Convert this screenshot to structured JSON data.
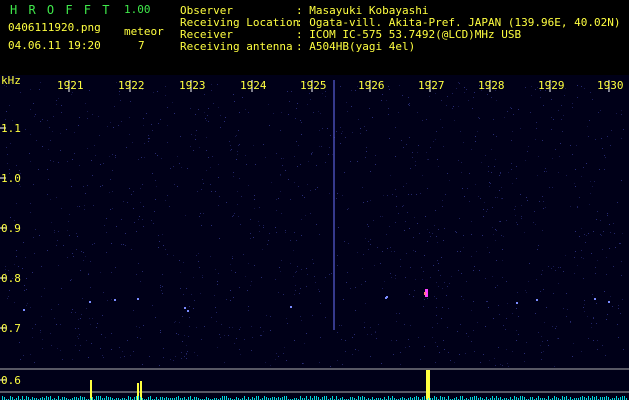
{
  "app": {
    "brand": "H R O F F T",
    "version": "1.00",
    "filename": "0406111920.png",
    "datetime": "04.06.11 19:20",
    "meteor_label": "meteor",
    "meteor_count": "7"
  },
  "info": {
    "rows": [
      {
        "label": "Observer",
        "value": ": Masayuki Kobayashi"
      },
      {
        "label": "Receiving Location",
        "value": ": Ogata-vill. Akita-Pref. JAPAN (139.96E, 40.02N)"
      },
      {
        "label": "Receiver",
        "value": ": ICOM IC-575 53.7492(@LCD)MHz USB"
      },
      {
        "label": "Receiving antenna",
        "value": ": A504HB(yagi 4el)"
      }
    ]
  },
  "spectrogram": {
    "unit_label": "kHz",
    "y_ticks": [
      "1.1",
      "1.0",
      "0.9",
      "0.8",
      "0.7",
      "0.6"
    ],
    "time_ticks": [
      "1921",
      "1922",
      "1923",
      "1924",
      "1925",
      "1926",
      "1927",
      "1928",
      "1929",
      "1930"
    ],
    "colors": {
      "background": "#000018",
      "noise": "#2a2e7a",
      "tick": "#ffffff",
      "label": "#ffff40",
      "bar": "#ffff40",
      "cyan": "#00ffff"
    }
  }
}
